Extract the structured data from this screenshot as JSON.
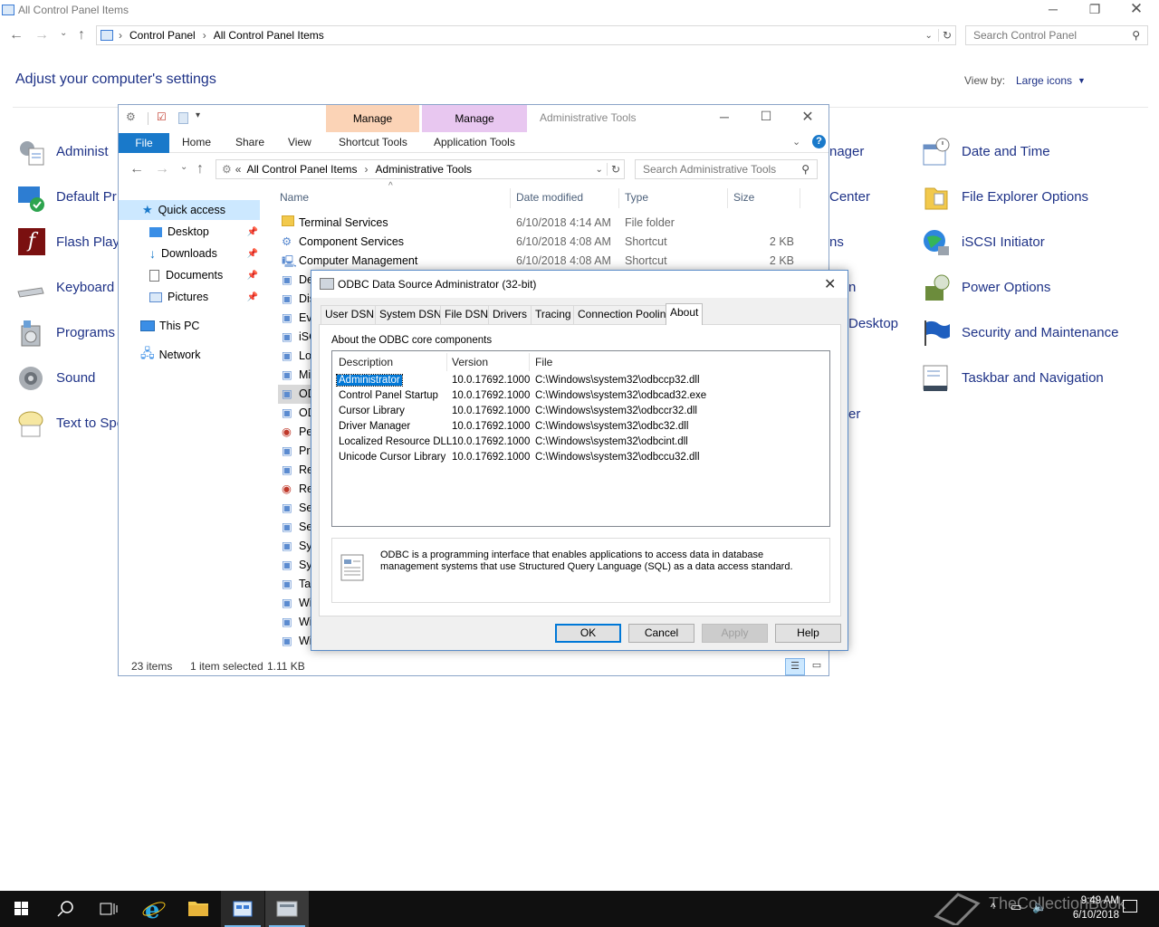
{
  "control_panel": {
    "title": "All Control Panel Items",
    "breadcrumb": [
      "Control Panel",
      "All Control Panel Items"
    ],
    "search_placeholder": "Search Control Panel",
    "heading": "Adjust your computer's settings",
    "view_by_label": "View by:",
    "view_by_value": "Large icons",
    "items_left": [
      "Administ",
      "Default Pr",
      "Flash Play",
      "Keyboard",
      "Programs",
      "Sound",
      "Text to Spe"
    ],
    "items_mid": [
      "nager",
      "Center",
      "ns",
      "n",
      "Desktop",
      "",
      "er"
    ],
    "items_right": [
      "Date and Time",
      "File Explorer Options",
      "iSCSI Initiator",
      "Power Options",
      "Security and Maintenance",
      "Taskbar and Navigation"
    ]
  },
  "explorer": {
    "title": "Administrative Tools",
    "manage_tabs": [
      "Manage",
      "Manage"
    ],
    "ribbon_tabs": [
      "File",
      "Home",
      "Share",
      "View",
      "Shortcut Tools",
      "Application Tools"
    ],
    "address": [
      "All Control Panel Items",
      "Administrative Tools"
    ],
    "address_prefix": "«",
    "search_placeholder": "Search Administrative Tools",
    "sidebar": {
      "quick_access": "Quick access",
      "pinned": [
        "Desktop",
        "Downloads",
        "Documents",
        "Pictures"
      ],
      "this_pc": "This PC",
      "network": "Network"
    },
    "columns": [
      "Name",
      "Date modified",
      "Type",
      "Size"
    ],
    "rows": [
      {
        "name": "Terminal Services",
        "date": "6/10/2018 4:14 AM",
        "type": "File folder",
        "size": ""
      },
      {
        "name": "Component Services",
        "date": "6/10/2018 4:08 AM",
        "type": "Shortcut",
        "size": "2 KB"
      },
      {
        "name": "Computer Management",
        "date": "6/10/2018 4:08 AM",
        "type": "Shortcut",
        "size": "2 KB"
      }
    ],
    "truncated_rows": [
      "De",
      "Dis",
      "Eve",
      "iSC",
      "Loc",
      "Mi",
      "OD",
      "OD",
      "Per",
      "Pri",
      "Re",
      "Res",
      "Ser",
      "Ser",
      "Sys",
      "Sys",
      "Tas",
      "Wi",
      "Wi",
      "Wi"
    ],
    "status": {
      "count": "23 items",
      "selection": "1 item selected",
      "size": "1.11 KB"
    }
  },
  "dialog": {
    "title": "ODBC Data Source Administrator (32-bit)",
    "tabs": [
      "User DSN",
      "System DSN",
      "File DSN",
      "Drivers",
      "Tracing",
      "Connection Pooling",
      "About"
    ],
    "section_label": "About the ODBC core components",
    "columns": [
      "Description",
      "Version",
      "File"
    ],
    "rows": [
      {
        "desc": "Administrator",
        "version": "10.0.17692.1000",
        "file": "C:\\Windows\\system32\\odbccp32.dll"
      },
      {
        "desc": "Control Panel Startup",
        "version": "10.0.17692.1000",
        "file": "C:\\Windows\\system32\\odbcad32.exe"
      },
      {
        "desc": "Cursor Library",
        "version": "10.0.17692.1000",
        "file": "C:\\Windows\\system32\\odbccr32.dll"
      },
      {
        "desc": "Driver Manager",
        "version": "10.0.17692.1000",
        "file": "C:\\Windows\\system32\\odbc32.dll"
      },
      {
        "desc": "Localized Resource DLL",
        "version": "10.0.17692.1000",
        "file": "C:\\Windows\\system32\\odbcint.dll"
      },
      {
        "desc": "Unicode Cursor Library",
        "version": "10.0.17692.1000",
        "file": "C:\\Windows\\system32\\odbccu32.dll"
      }
    ],
    "info_text": "ODBC is a programming interface that enables applications to access data in database management systems that use Structured Query Language (SQL) as a data access standard.",
    "buttons": {
      "ok": "OK",
      "cancel": "Cancel",
      "apply": "Apply",
      "help": "Help"
    }
  },
  "taskbar": {
    "time": "9:49 AM",
    "date": "6/10/2018",
    "watermark": "TheCollectionBook"
  }
}
